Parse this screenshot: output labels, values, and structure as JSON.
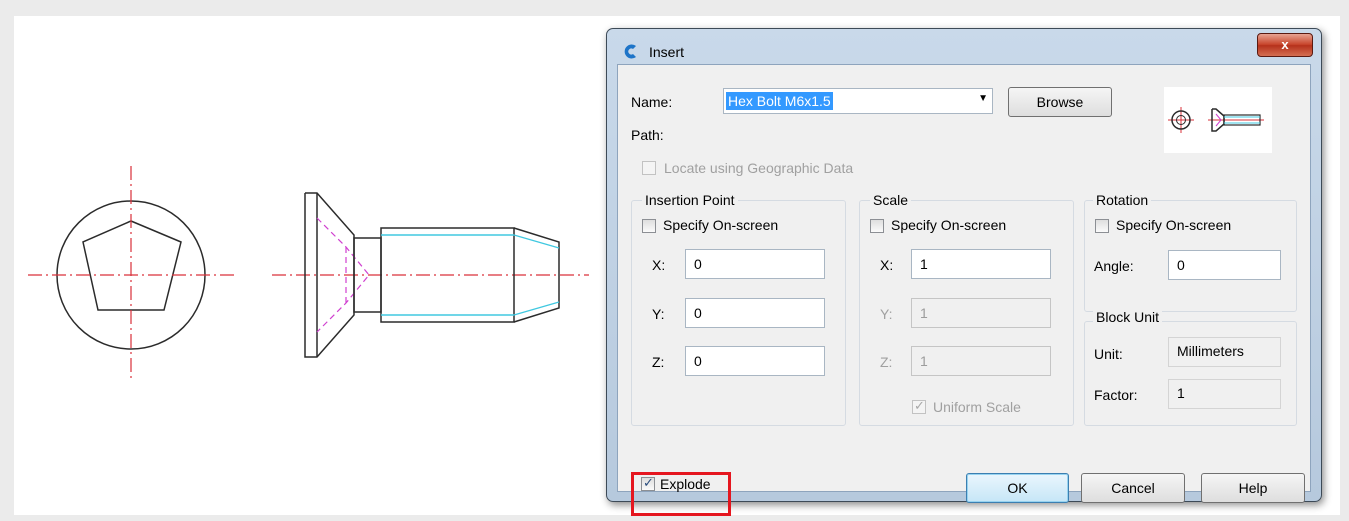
{
  "dialog": {
    "title": "Insert",
    "close_label": "x",
    "name_label": "Name:",
    "name_value": "Hex Bolt M6x1.5",
    "browse_label": "Browse",
    "path_label": "Path:",
    "geo_label": "Locate using Geographic Data",
    "insertion_point": {
      "title": "Insertion Point",
      "specify_label": "Specify On-screen",
      "x_label": "X:",
      "x_value": "0",
      "y_label": "Y:",
      "y_value": "0",
      "z_label": "Z:",
      "z_value": "0"
    },
    "scale": {
      "title": "Scale",
      "specify_label": "Specify On-screen",
      "x_label": "X:",
      "x_value": "1",
      "y_label": "Y:",
      "y_value": "1",
      "z_label": "Z:",
      "z_value": "1",
      "uniform_label": "Uniform Scale"
    },
    "rotation": {
      "title": "Rotation",
      "specify_label": "Specify On-screen",
      "angle_label": "Angle:",
      "angle_value": "0"
    },
    "block_unit": {
      "title": "Block Unit",
      "unit_label": "Unit:",
      "unit_value": "Millimeters",
      "factor_label": "Factor:",
      "factor_value": "1"
    },
    "explode_label": "Explode",
    "ok_label": "OK",
    "cancel_label": "Cancel",
    "help_label": "Help"
  },
  "state": {
    "explode_checked": true,
    "uniform_scale_checked": true,
    "geo_checked": false,
    "insertion_specify_checked": false,
    "scale_specify_checked": false,
    "rotation_specify_checked": false
  },
  "colors": {
    "centerline": "#d9303a",
    "outline": "#2b2b2b",
    "hidden_line": "#d040d0",
    "thread_line": "#40c8e0",
    "highlight": "#e5161f"
  }
}
